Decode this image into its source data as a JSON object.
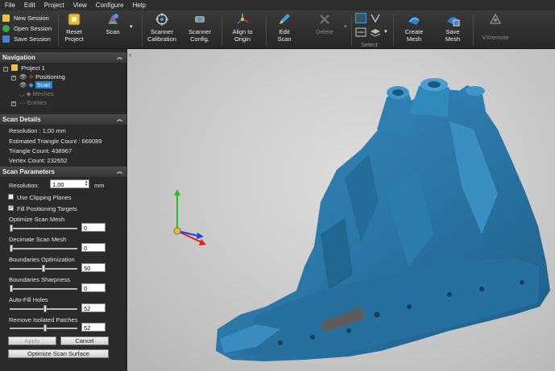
{
  "menu": [
    "File",
    "Edit",
    "Project",
    "View",
    "Configure",
    "Help"
  ],
  "session": {
    "new": "New Session",
    "open": "Open Session",
    "save": "Save Session"
  },
  "ribbon": {
    "reset_project": [
      "Reset",
      "Project"
    ],
    "scan": "Scan",
    "scanner_calibration": [
      "Scanner",
      "Calibration"
    ],
    "scanner_config": [
      "Scanner",
      "Config."
    ],
    "align_to_origin": [
      "Align to",
      "Origin"
    ],
    "edit_scan": [
      "Edit",
      "Scan"
    ],
    "delete": "Delete",
    "select": "Select",
    "create_mesh": [
      "Create",
      "Mesh"
    ],
    "save_mesh": [
      "Save",
      "Mesh"
    ],
    "vxremote": "VXremote"
  },
  "navigation": {
    "title": "Navigation",
    "project": "Project 1",
    "positioning": "Positioning",
    "scan": "Scan",
    "meshes": "Meshes",
    "entities": "Entities"
  },
  "scan_details": {
    "title": "Scan Details",
    "resolution": "Resolution : 1,00 mm",
    "est_triangles": "Estimated Triangle Count : 669089",
    "triangles": "Triangle Count: 438967",
    "vertices": "Vertex Count: 232652"
  },
  "scan_parameters": {
    "title": "Scan Parameters",
    "resolution_label": "Resolution:",
    "resolution_value": "1,00",
    "resolution_unit": "mm",
    "use_clipping": "Use Clipping Planes",
    "use_clipping_checked": false,
    "fill_targets": "Fill Positioning Targets",
    "fill_targets_checked": true,
    "sliders": [
      {
        "label": "Optimize Scan Mesh",
        "value": "0",
        "level": 0
      },
      {
        "label": "Decimate Scan Mesh",
        "value": "0",
        "level": 0
      },
      {
        "label": "Boundaries Optimization",
        "value": "50",
        "level": 0.5
      },
      {
        "label": "Boundaries Sharpness",
        "value": "0",
        "level": 0
      },
      {
        "label": "Auto-Fill Holes",
        "value": "52",
        "level": 0.52
      },
      {
        "label": "Remove Isolated Patches",
        "value": "52",
        "level": 0.52
      }
    ],
    "apply": "Apply",
    "cancel": "Cancel",
    "optimize": "Optimize Scan Surface"
  },
  "colors": {
    "model": "#2a76a6",
    "selection": "#2f7fd6",
    "axis_x": "#e01f1f",
    "axis_y": "#22c02a",
    "axis_z": "#1f3fe0"
  }
}
